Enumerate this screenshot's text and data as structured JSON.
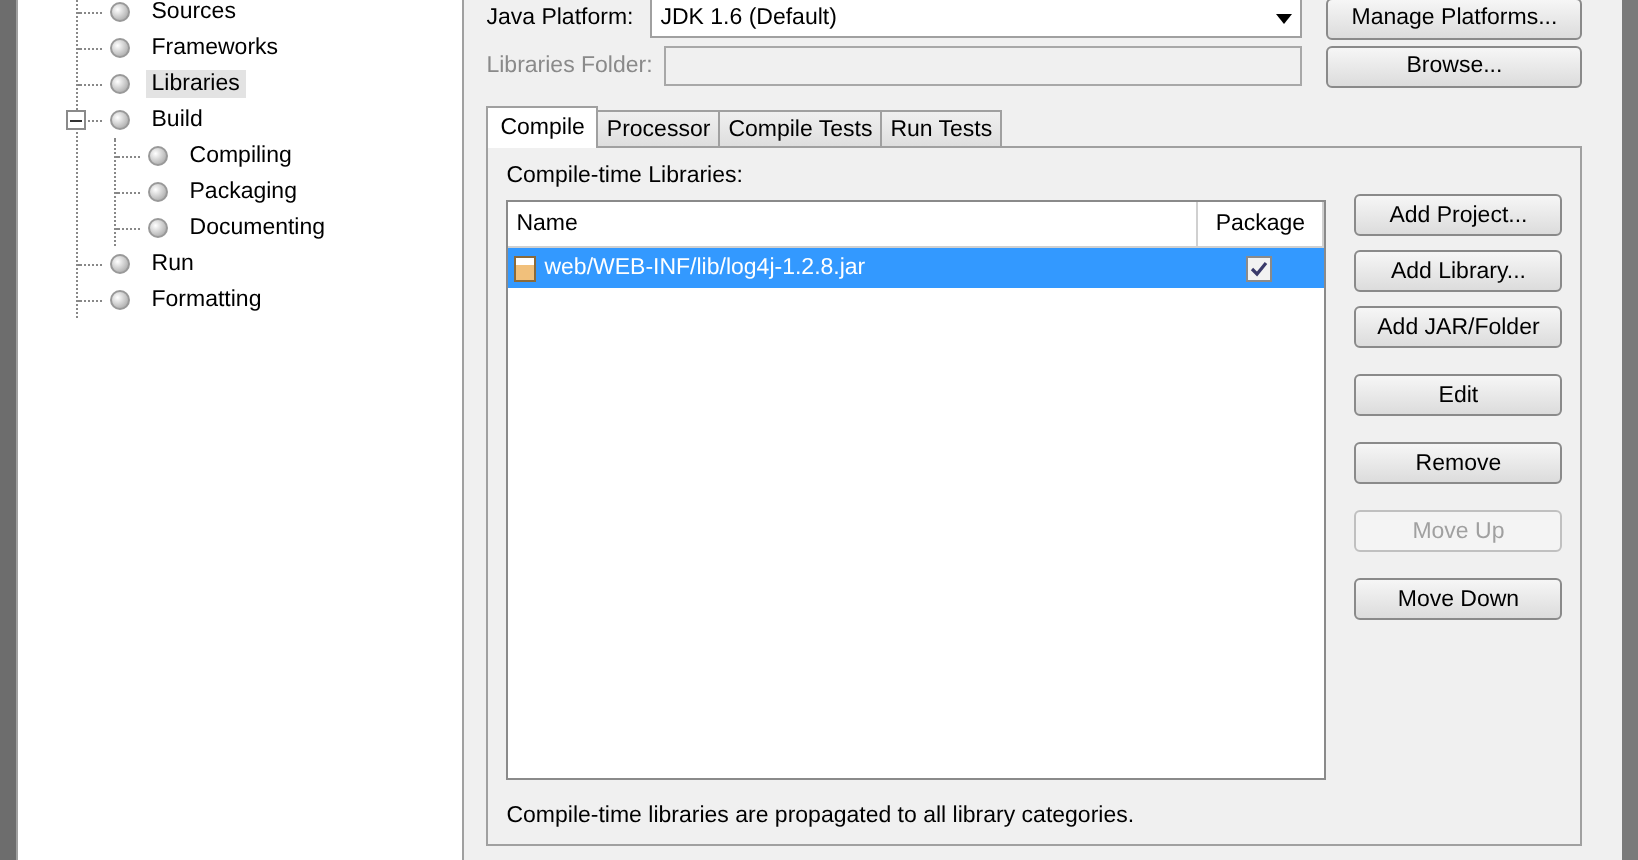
{
  "tree": [
    {
      "label": "Sources",
      "selected": false
    },
    {
      "label": "Frameworks",
      "selected": false
    },
    {
      "label": "Libraries",
      "selected": true
    },
    {
      "label": "Build",
      "selected": false,
      "expanded": true,
      "children": [
        {
          "label": "Compiling",
          "selected": false
        },
        {
          "label": "Packaging",
          "selected": false
        },
        {
          "label": "Documenting",
          "selected": false
        }
      ]
    },
    {
      "label": "Run",
      "selected": false
    },
    {
      "label": "Formatting",
      "selected": false
    }
  ],
  "platform": {
    "label": "Java Platform:",
    "value": "JDK 1.6 (Default)",
    "button": "Manage Platforms..."
  },
  "libraries_folder": {
    "label": "Libraries Folder:",
    "disabled": true,
    "button": "Browse..."
  },
  "tabs": [
    {
      "label": "Compile",
      "selected": true
    },
    {
      "label": "Processor",
      "selected": false
    },
    {
      "label": "Compile Tests",
      "selected": false
    },
    {
      "label": "Run Tests",
      "selected": false
    }
  ],
  "list_label": "Compile-time Libraries:",
  "table": {
    "columns": [
      "Name",
      "Package"
    ],
    "rows": [
      {
        "name": "web/WEB-INF/lib/log4j-1.2.8.jar",
        "package": true,
        "selected": true
      }
    ]
  },
  "buttons": [
    {
      "label": "Add Project...",
      "disabled": false
    },
    {
      "label": "Add Library...",
      "disabled": false
    },
    {
      "label": "Add JAR/Folder",
      "disabled": false
    },
    {
      "label": "Edit",
      "disabled": false
    },
    {
      "label": "Remove",
      "disabled": false
    },
    {
      "label": "Move Up",
      "disabled": true
    },
    {
      "label": "Move Down",
      "disabled": false
    }
  ],
  "note": "Compile-time libraries are propagated to all library categories."
}
